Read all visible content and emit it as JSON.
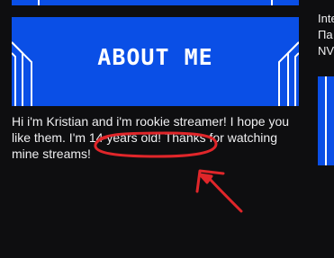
{
  "about": {
    "title": "About me",
    "description": "Hi i'm Kristian and i'm rookie streamer! I hope you like them. I'm 14 years old! Thanks for watching mine streams!"
  },
  "right_column": {
    "line1": "Inte",
    "line2": "Па",
    "line3": "NV"
  },
  "colors": {
    "panel_blue": "#0a4fe6",
    "annotation_red": "#e0262a",
    "background": "#0e0e10"
  }
}
